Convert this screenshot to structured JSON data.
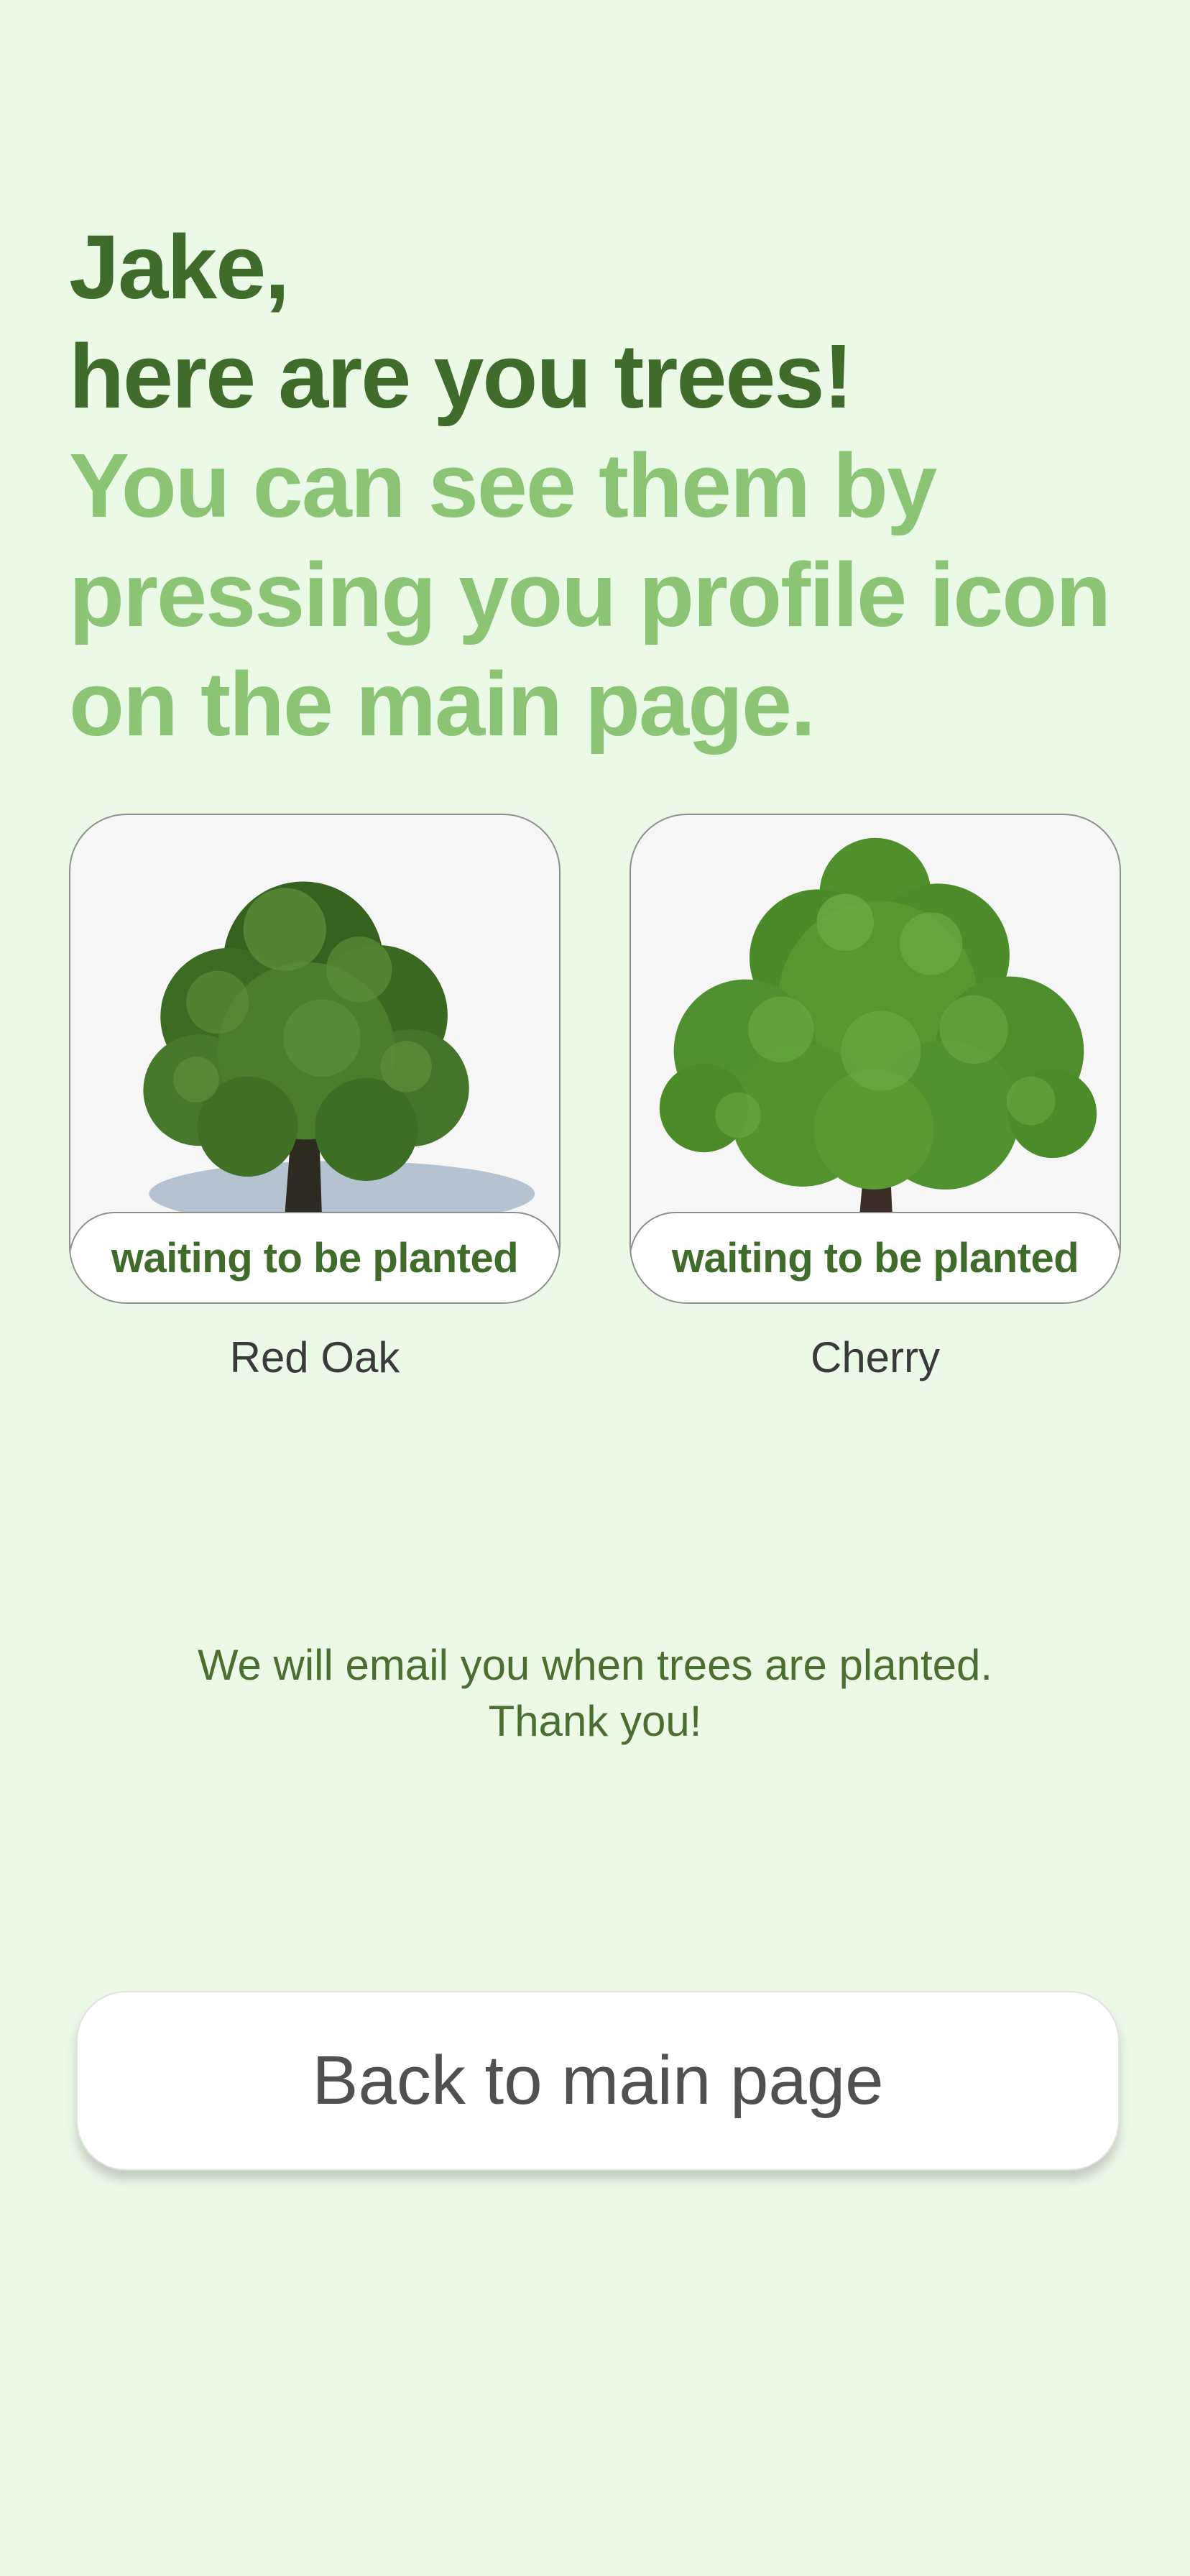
{
  "heading": {
    "line1": "Jake,",
    "line2": "here are you trees!",
    "subline1": "You can see them by",
    "subline2": "pressing you profile icon",
    "subline3": "on the main page."
  },
  "trees": [
    {
      "name": "Red Oak",
      "status": "waiting to be planted",
      "icon": "red-oak-tree-image"
    },
    {
      "name": "Cherry",
      "status": "waiting to be planted",
      "icon": "cherry-tree-image"
    }
  ],
  "notice": {
    "line1": "We will email you when trees are planted.",
    "line2": "Thank you!"
  },
  "back_button": {
    "label": "Back to main page"
  },
  "colors": {
    "background": "#ebf9e7",
    "dark_green": "#3f6b2b",
    "light_green": "#8bc474",
    "notice_green": "#4b6e31"
  }
}
